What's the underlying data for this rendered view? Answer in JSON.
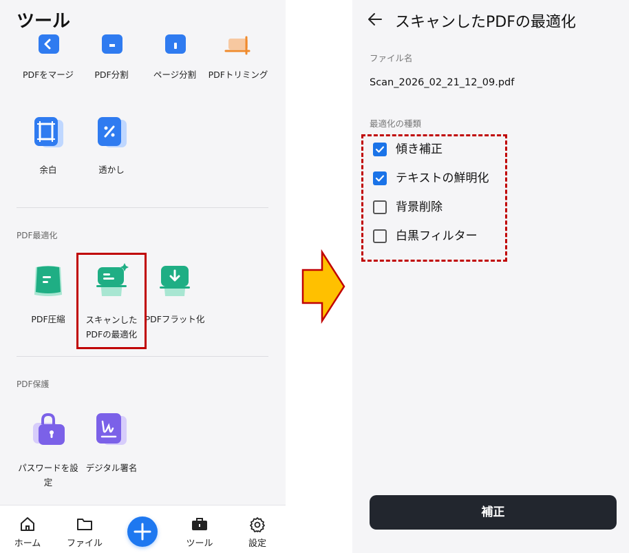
{
  "left": {
    "page_title": "ツール",
    "tools_row1": [
      "PDFをマージ",
      "PDF分割",
      "ページ分割",
      "PDFトリミング"
    ],
    "tools_row2": [
      "余白",
      "透かし"
    ],
    "sections": {
      "optimize": {
        "title": "PDF最適化",
        "tools": [
          "PDF圧縮",
          "スキャンした\nPDFの最適化",
          "PDFフラット化"
        ]
      },
      "protect": {
        "title": "PDF保護",
        "tools": [
          "パスワードを設\n定",
          "デジタル署名"
        ]
      }
    },
    "bottom_nav": [
      "ホーム",
      "ファイル",
      "ツール",
      "設定"
    ]
  },
  "right": {
    "title": "スキャンしたPDFの最適化",
    "file_label": "ファイル名",
    "file_name": "Scan_2026_02_21_12_09.pdf",
    "type_label": "最適化の種類",
    "options": [
      {
        "label": "傾き補正",
        "checked": true
      },
      {
        "label": "テキストの鮮明化",
        "checked": true
      },
      {
        "label": "背景削除",
        "checked": false
      },
      {
        "label": "白黒フィルター",
        "checked": false
      }
    ],
    "primary_button": "補正"
  },
  "colors": {
    "accent_blue": "#1a73e8",
    "highlight_red": "#c00000",
    "arrow_fill": "#ffc000",
    "button_dark": "#22262e"
  }
}
